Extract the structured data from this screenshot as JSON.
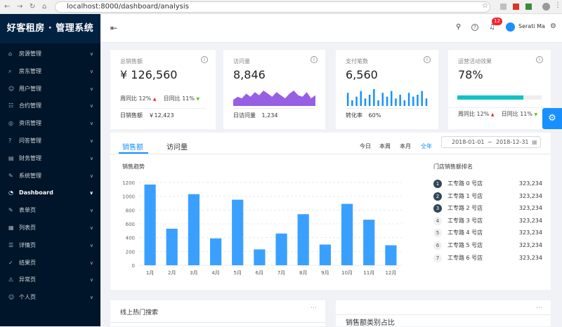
{
  "browser": {
    "url": "localhost:8000/dashboard/analysis"
  },
  "app": {
    "title": "好客租房 · 管理系统",
    "accent": "#1890ff",
    "sidebar_bg": "#001529"
  },
  "sidebar": {
    "items": [
      {
        "label": "房源管理",
        "icon": "home-icon"
      },
      {
        "label": "房东管理",
        "icon": "search-icon"
      },
      {
        "label": "用户管理",
        "icon": "user-icon"
      },
      {
        "label": "合约管理",
        "icon": "document-icon"
      },
      {
        "label": "资讯管理",
        "icon": "globe-icon"
      },
      {
        "label": "问答管理",
        "icon": "question-icon"
      },
      {
        "label": "财务管理",
        "icon": "money-icon"
      },
      {
        "label": "系统管理",
        "icon": "form-icon"
      },
      {
        "label": "Dashboard",
        "icon": "dashboard-icon",
        "active": true
      },
      {
        "label": "表单页",
        "icon": "form-icon"
      },
      {
        "label": "列表页",
        "icon": "table-icon"
      },
      {
        "label": "详情页",
        "icon": "profile-icon"
      },
      {
        "label": "结果页",
        "icon": "check-circle-icon"
      },
      {
        "label": "异常页",
        "icon": "warning-icon"
      },
      {
        "label": "个人页",
        "icon": "user-icon"
      }
    ]
  },
  "header": {
    "notification_count": "12",
    "username": "Serati Ma"
  },
  "stats": [
    {
      "title": "总销售额",
      "value": "¥ 126,560",
      "trend_week_label": "周同比",
      "trend_week": "12%",
      "trend_day_label": "日同比",
      "trend_day": "11%",
      "footer_label": "日销售额",
      "footer_value": "￥12,423"
    },
    {
      "title": "访问量",
      "value": "8,846",
      "footer_label": "日访问量",
      "footer_value": "1,234",
      "mini_area": [
        3,
        5,
        4,
        7,
        5,
        8,
        6,
        9,
        7,
        5,
        8,
        6,
        4,
        7,
        9,
        6,
        5,
        8,
        4,
        6
      ]
    },
    {
      "title": "支付笔数",
      "value": "6,560",
      "footer_label": "转化率",
      "footer_value": "60%",
      "mini_bars": [
        7,
        3,
        5,
        8,
        4,
        6,
        9,
        3,
        7,
        5,
        8,
        4,
        6,
        3,
        7,
        5,
        6,
        8,
        4
      ]
    },
    {
      "title": "运营活动效果",
      "value": "78%",
      "progress": 0.78,
      "trend_week_label": "周同比",
      "trend_week": "12%",
      "trend_day_label": "日同比",
      "trend_day": "11%"
    }
  ],
  "sales": {
    "tabs": [
      "销售额",
      "访问量"
    ],
    "ranges": [
      "今日",
      "本周",
      "本月",
      "全年"
    ],
    "active_range": "全年",
    "date_start": "2018-01-01",
    "date_sep": "~",
    "date_end": "2018-12-31",
    "chart_title": "销售趋势",
    "rank_title": "门店销售额排名",
    "ranking": [
      {
        "rank": "1",
        "name": "工专路 0 号店",
        "value": "323,234"
      },
      {
        "rank": "2",
        "name": "工专路 1 号店",
        "value": "323,234"
      },
      {
        "rank": "3",
        "name": "工专路 2 号店",
        "value": "323,234"
      },
      {
        "rank": "4",
        "name": "工专路 3 号店",
        "value": "323,234"
      },
      {
        "rank": "5",
        "name": "工专路 4 号店",
        "value": "323,234"
      },
      {
        "rank": "6",
        "name": "工专路 5 号店",
        "value": "323,234"
      },
      {
        "rank": "7",
        "name": "工专路 6 号店",
        "value": "323,234"
      }
    ]
  },
  "bottom": {
    "search_title": "线上热门搜索",
    "category_title": "销售额类别占比"
  },
  "chart_data": {
    "type": "bar",
    "title": "销售趋势",
    "categories": [
      "1月",
      "2月",
      "3月",
      "4月",
      "5月",
      "6月",
      "7月",
      "8月",
      "9月",
      "10月",
      "11月",
      "12月"
    ],
    "values": [
      1170,
      530,
      1030,
      390,
      950,
      230,
      460,
      740,
      300,
      890,
      660,
      290
    ],
    "ylim": [
      0,
      1200
    ],
    "yticks": [
      0,
      200,
      400,
      600,
      800,
      1000,
      1200
    ],
    "color": "#3aa0ff",
    "grid": true
  }
}
